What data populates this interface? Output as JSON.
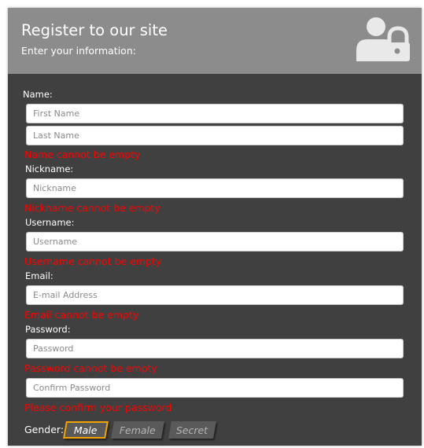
{
  "header": {
    "title": "Register to our site",
    "subtitle": "Enter your information:",
    "icon": "user-lock-icon"
  },
  "form": {
    "name_label": "Name:",
    "first_name_placeholder": "First Name",
    "last_name_placeholder": "Last Name",
    "name_error": "Name cannot be empty",
    "nickname_label": "Nickname:",
    "nickname_placeholder": "Nickname",
    "nickname_error": "Nickname cannot be empty",
    "username_label": "Username:",
    "username_placeholder": "Username",
    "username_error": "Username cannot be empty",
    "email_label": "Email:",
    "email_placeholder": "E-mail Address",
    "email_error": "Email cannot be empty",
    "password_label": "Password:",
    "password_placeholder": "Password",
    "password_error": "Password cannot be empty",
    "confirm_placeholder": "Confirm Password",
    "confirm_error": "Please confirm your password",
    "gender_label": "Gender:",
    "gender_options": [
      "Male",
      "Female",
      "Secret"
    ],
    "gender_selected": "Male"
  },
  "colors": {
    "card_bg": "#404040",
    "header_bg": "#8c8c8c",
    "error": "#ff0000",
    "selected_border": "#f3a200"
  }
}
